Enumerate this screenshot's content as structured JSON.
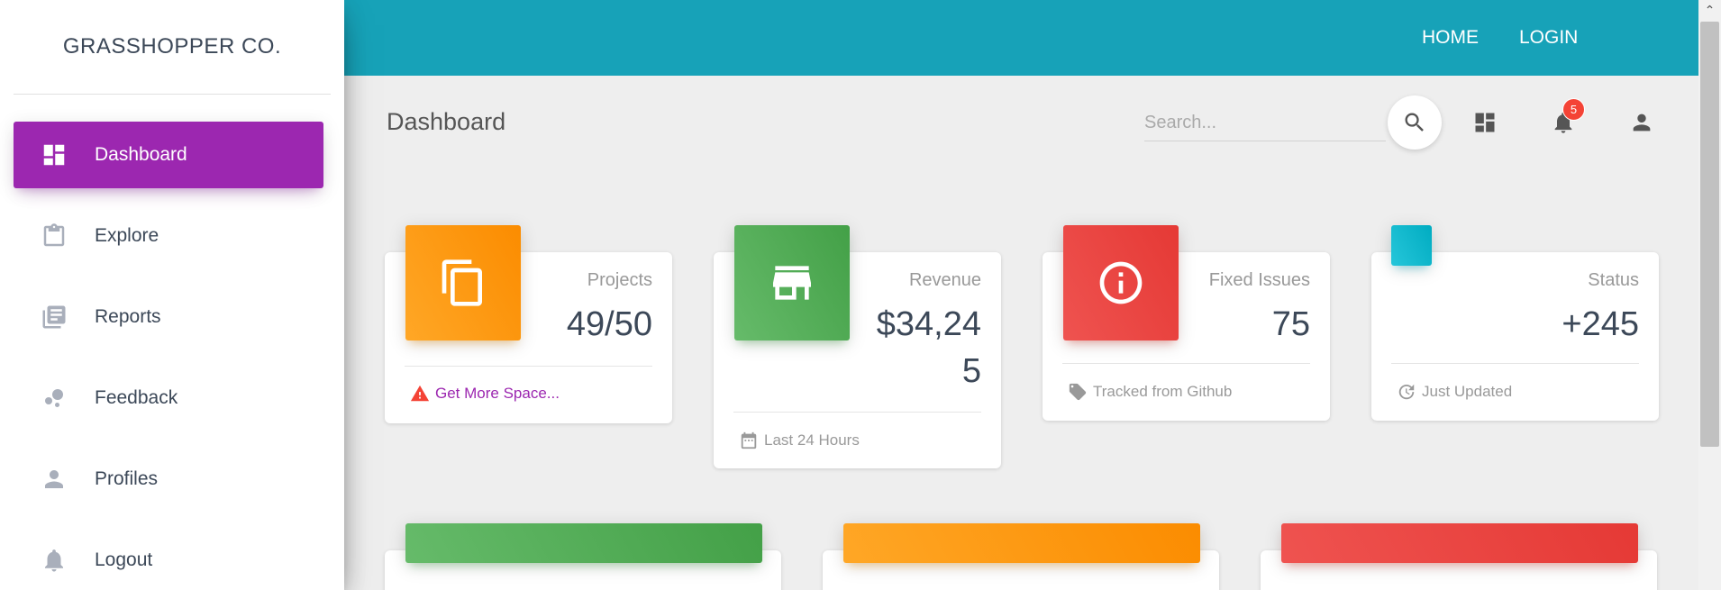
{
  "brand": "GRASSHOPPER CO.",
  "sidebar": {
    "items": [
      {
        "label": "Dashboard",
        "icon": "dashboard-icon",
        "active": true
      },
      {
        "label": "Explore",
        "icon": "clipboard-icon",
        "active": false
      },
      {
        "label": "Reports",
        "icon": "library-books-icon",
        "active": false
      },
      {
        "label": "Feedback",
        "icon": "bubble-chart-icon",
        "active": false
      },
      {
        "label": "Profiles",
        "icon": "person-icon",
        "active": false
      },
      {
        "label": "Logout",
        "icon": "notifications-icon",
        "active": false
      }
    ]
  },
  "topnav": {
    "home": "HOME",
    "login": "LOGIN"
  },
  "header": {
    "title": "Dashboard",
    "search_placeholder": "Search...",
    "notification_count": "5"
  },
  "cards": [
    {
      "category": "Projects",
      "value": "49/50",
      "footer": "Get More Space...",
      "footer_icon": "warning-icon",
      "color": "#ff9800"
    },
    {
      "category": "Revenue",
      "value": "$34,245",
      "value_line1": "$34,24",
      "value_line2": "5",
      "footer": "Last 24 Hours",
      "footer_icon": "calendar-icon",
      "color": "#4caf50"
    },
    {
      "category": "Fixed Issues",
      "value": "75",
      "footer": "Tracked from Github",
      "footer_icon": "tag-icon",
      "color": "#f44336"
    },
    {
      "category": "Status",
      "value": "+245",
      "footer": "Just Updated",
      "footer_icon": "update-icon",
      "color": "#00bcd4"
    }
  ],
  "colors": {
    "accent": "#9c27b0",
    "topbar": "#17a2b8",
    "warning": "#f44336",
    "link": "#9c27b0"
  }
}
